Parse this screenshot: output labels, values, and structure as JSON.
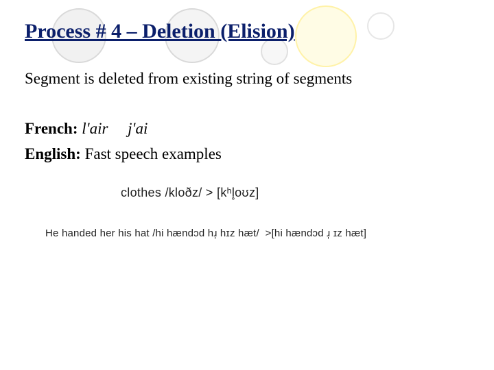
{
  "title": "Process # 4 – Deletion (Elision)",
  "description": "Segment is deleted from existing string of segments",
  "french_label": "French:",
  "french_ex1": "l'air",
  "french_ex2": "j'ai",
  "english_label": "English:",
  "english_text": "Fast speech examples",
  "example1": {
    "word": "clothes",
    "underlying": "/kloðz/",
    "arrow": ">",
    "surface": "[kʰl̥oʊz]"
  },
  "example2": {
    "sentence": "He handed her his hat",
    "underlying": "/hi hændɔd hɹ̩ hɪz hæt/",
    "arrow": ">",
    "surface": "[hi hændɔd ɹ̩ ɪz hæt]"
  }
}
